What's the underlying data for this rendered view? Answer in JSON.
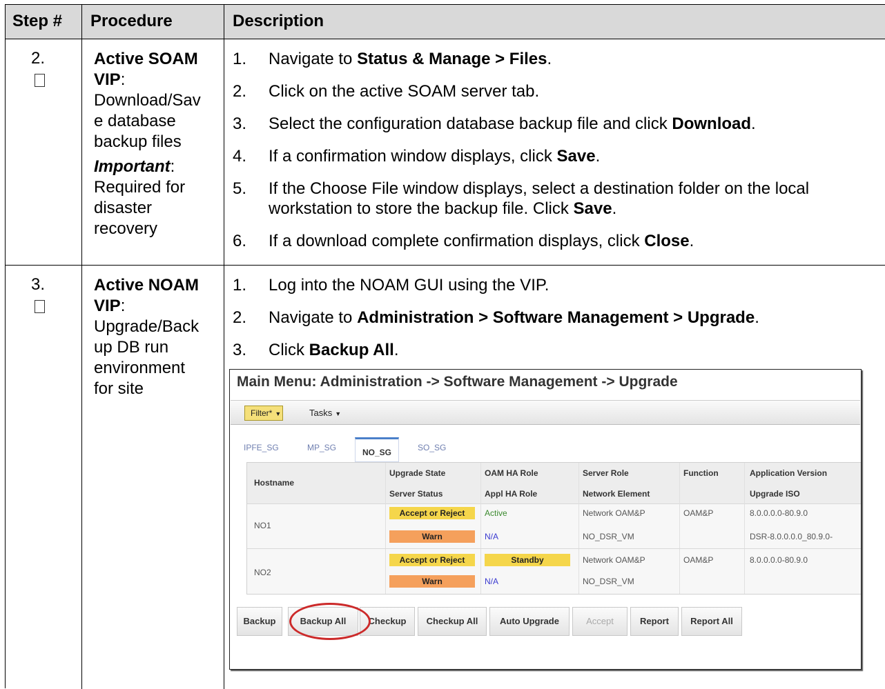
{
  "header": {
    "step": "Step #",
    "procedure": "Procedure",
    "description": "Description"
  },
  "rows": [
    {
      "step": "2.",
      "proc_title": "Active SOAM VIP",
      "proc_colon": ":",
      "proc_lines": [
        "Download/Sav",
        "e database",
        "backup files"
      ],
      "important_label": "Important",
      "important_colon": ":",
      "important_lines": [
        "Required for",
        "disaster",
        "recovery"
      ],
      "steps": [
        {
          "n": "1.",
          "pre": "Navigate to ",
          "bold": "Status & Manage > Files",
          "post": "."
        },
        {
          "n": "2.",
          "pre": "Click on the active SOAM server tab.",
          "bold": "",
          "post": ""
        },
        {
          "n": "3.",
          "pre": "Select the configuration database backup file and click ",
          "bold": "Download",
          "post": "."
        },
        {
          "n": "4.",
          "pre": "If a confirmation window displays, click ",
          "bold": "Save",
          "post": "."
        },
        {
          "n": "5.",
          "pre": "If the Choose File window displays, select a destination folder on the local workstation to store the backup file.  Click ",
          "bold": "Save",
          "post": "."
        },
        {
          "n": "6.",
          "pre": "If a download complete confirmation displays, click ",
          "bold": "Close",
          "post": "."
        }
      ]
    },
    {
      "step": "3.",
      "proc_title": "Active NOAM VIP",
      "proc_colon": ":",
      "proc_lines": [
        "Upgrade/Back",
        "up DB run",
        "environment",
        "for site"
      ],
      "steps": [
        {
          "n": "1.",
          "pre": "Log into the NOAM GUI using the VIP.",
          "bold": "",
          "post": ""
        },
        {
          "n": "2.",
          "pre": "Navigate to ",
          "bold": "Administration > Software Management > Upgrade",
          "post": "."
        },
        {
          "n": "3.",
          "pre": "Click ",
          "bold": "Backup All",
          "post": "."
        }
      ]
    }
  ],
  "screenshot": {
    "title": "Main Menu: Administration -> Software Management -> Upgrade",
    "filter_label": "Filter*",
    "tasks_label": "Tasks",
    "dropdown_glyph": "▼",
    "tabs": [
      "IPFE_SG",
      "MP_SG",
      "NO_SG",
      "SO_SG"
    ],
    "active_tab": "NO_SG",
    "columns": {
      "hostname": "Hostname",
      "upgrade_state": "Upgrade State",
      "server_status": "Server Status",
      "oam_ha_role": "OAM HA Role",
      "appl_ha_role": "Appl HA Role",
      "server_role": "Server Role",
      "network_element": "Network Element",
      "function": "Function",
      "application_version": "Application Version",
      "upgrade_iso": "Upgrade ISO"
    },
    "servers": [
      {
        "hostname": "NO1",
        "upgrade_state": "Accept or Reject",
        "server_status": "Warn",
        "oam_ha_role": "Active",
        "appl_ha_role": "N/A",
        "server_role": "Network OAM&P",
        "network_element": "NO_DSR_VM",
        "function": "OAM&P",
        "application_version": "8.0.0.0.0-80.9.0",
        "upgrade_iso": "DSR-8.0.0.0.0_80.9.0-"
      },
      {
        "hostname": "NO2",
        "upgrade_state": "Accept or Reject",
        "server_status": "Warn",
        "oam_ha_role": "Standby",
        "appl_ha_role": "N/A",
        "server_role": "Network OAM&P",
        "network_element": "NO_DSR_VM",
        "function": "OAM&P",
        "application_version": "8.0.0.0.0-80.9.0",
        "upgrade_iso": ""
      }
    ],
    "buttons": [
      "Backup",
      "Backup All",
      "Checkup",
      "Checkup All",
      "Auto Upgrade",
      "Accept",
      "Report",
      "Report All"
    ],
    "colors": {
      "state_yellow": "#f5d64b",
      "status_orange": "#f5a05c",
      "highlight_red": "#cc2a2a",
      "active_green": "#3b8a2e",
      "na_blue": "#3a3ad0"
    }
  }
}
